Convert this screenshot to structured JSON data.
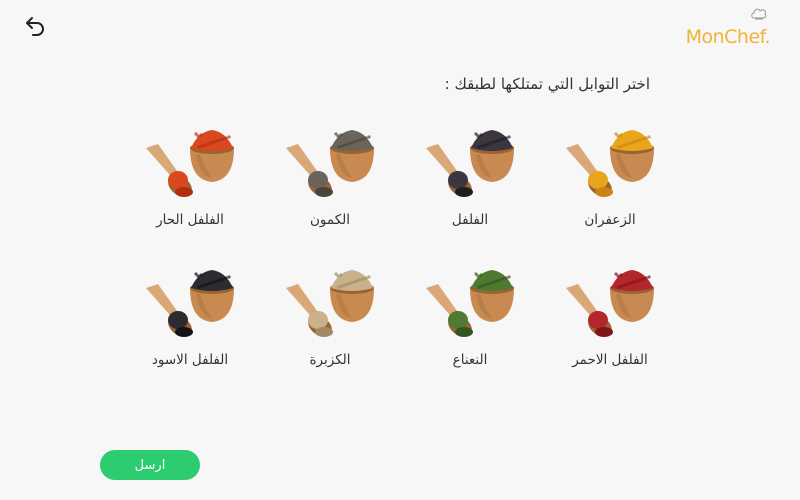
{
  "header": {
    "back_icon": "undo-arrow-icon",
    "logo_text": "MonChef."
  },
  "prompt": "اختر التوابل التي تمتلكها لطبقك :",
  "spices": [
    {
      "label": "الزعفران",
      "color": "#e9a51c",
      "dark": "#c98411"
    },
    {
      "label": "الفلفل",
      "color": "#3b3640",
      "dark": "#1f1c22"
    },
    {
      "label": "الكمون",
      "color": "#6b6458",
      "dark": "#4a443b"
    },
    {
      "label": "الفلفل الحار",
      "color": "#d9481f",
      "dark": "#b02f10"
    },
    {
      "label": "الفلفل الاحمر",
      "color": "#b3262c",
      "dark": "#7e1418"
    },
    {
      "label": "النعناع",
      "color": "#4f7a32",
      "dark": "#345420"
    },
    {
      "label": "الكزبرة",
      "color": "#c9b18c",
      "dark": "#a08a66"
    },
    {
      "label": "الفلفل الاسود",
      "color": "#2b2b30",
      "dark": "#141416"
    }
  ],
  "send_label": "ارسل",
  "colors": {
    "accent": "#2ecc71",
    "logo": "#f2b233",
    "bowl": "#c98a52",
    "bowl_dark": "#9c6332",
    "scoop": "#d9a876"
  }
}
